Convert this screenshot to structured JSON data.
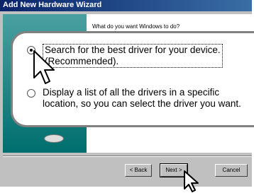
{
  "window": {
    "title": "Add New Hardware Wizard"
  },
  "wizard": {
    "prompt": "What do you want Windows to do?",
    "options": [
      {
        "label_line1": "Search for the best driver for your device.",
        "label_line2": "(Recommended).",
        "selected": true
      },
      {
        "label_line1": "Display a list of all the drivers in a specific",
        "label_line2": "location, so you can select the driver you want.",
        "selected": false
      }
    ]
  },
  "buttons": {
    "back": "< Back",
    "next": "Next >",
    "cancel": "Cancel"
  },
  "colors": {
    "titlebar": "#0a246a",
    "face": "#c0c0c0",
    "art": "#008080"
  },
  "icons": [
    "cursor-arrow-icon",
    "cd-icon"
  ]
}
